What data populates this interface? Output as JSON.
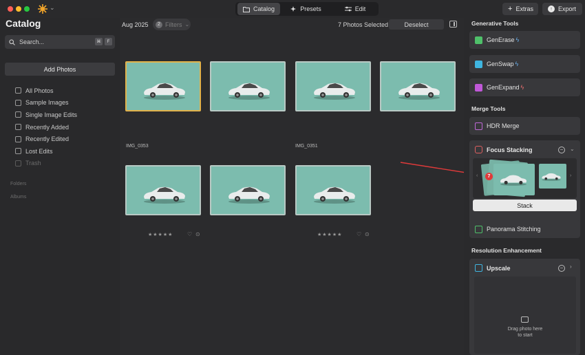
{
  "window": {
    "tabs": [
      {
        "label": "Catalog",
        "icon": "folder-icon",
        "active": true
      },
      {
        "label": "Presets",
        "icon": "sparkle-icon",
        "active": false
      },
      {
        "label": "Edit",
        "icon": "sliders-icon",
        "active": false
      }
    ],
    "extras_label": "Extras",
    "export_label": "Export"
  },
  "sidebar": {
    "title": "Catalog",
    "search_placeholder": "Search...",
    "shortcut_keys": [
      "⌘",
      "F"
    ],
    "add_photos_label": "Add Photos",
    "items": [
      {
        "label": "All Photos",
        "enabled": true
      },
      {
        "label": "Sample Images",
        "enabled": true
      },
      {
        "label": "Single Image Edits",
        "enabled": true
      },
      {
        "label": "Recently Added",
        "enabled": true
      },
      {
        "label": "Recently Edited",
        "enabled": true
      },
      {
        "label": "Lost Edits",
        "enabled": true
      },
      {
        "label": "Trash",
        "enabled": false
      }
    ],
    "folders_label": "Folders",
    "albums_label": "Albums"
  },
  "main": {
    "date_label": "Aug 2025",
    "filters_count": "2",
    "filters_label": "Filters",
    "selected_count_label": "7 Photos Selected",
    "deselect_label": "Deselect",
    "photo_names": [
      "IMG_0353",
      "IMG_0351"
    ],
    "stars": "★★★★★",
    "heart_glyph": "♡",
    "info_glyph": "⊙"
  },
  "right_panel": {
    "generative_title": "Generative Tools",
    "generative_tools": [
      {
        "label": "GenErase",
        "color": "#4fc06a"
      },
      {
        "label": "GenSwap",
        "color": "#3fb5e0"
      },
      {
        "label": "GenExpand",
        "color": "#c058d8"
      }
    ],
    "merge_title": "Merge Tools",
    "hdr_label": "HDR Merge",
    "focus_stacking_label": "Focus Stacking",
    "focus_stack_count": "7",
    "stack_button_label": "Stack",
    "panorama_label": "Panorama Stitching",
    "resolution_title": "Resolution Enhancement",
    "upscale_label": "Upscale",
    "drop_line1": "Drag photo here",
    "drop_line2": "to start"
  },
  "colors": {
    "accent_selected": "#e2b24a",
    "arrow": "#e03a3a",
    "thumb_bg": "#7cbcae"
  }
}
